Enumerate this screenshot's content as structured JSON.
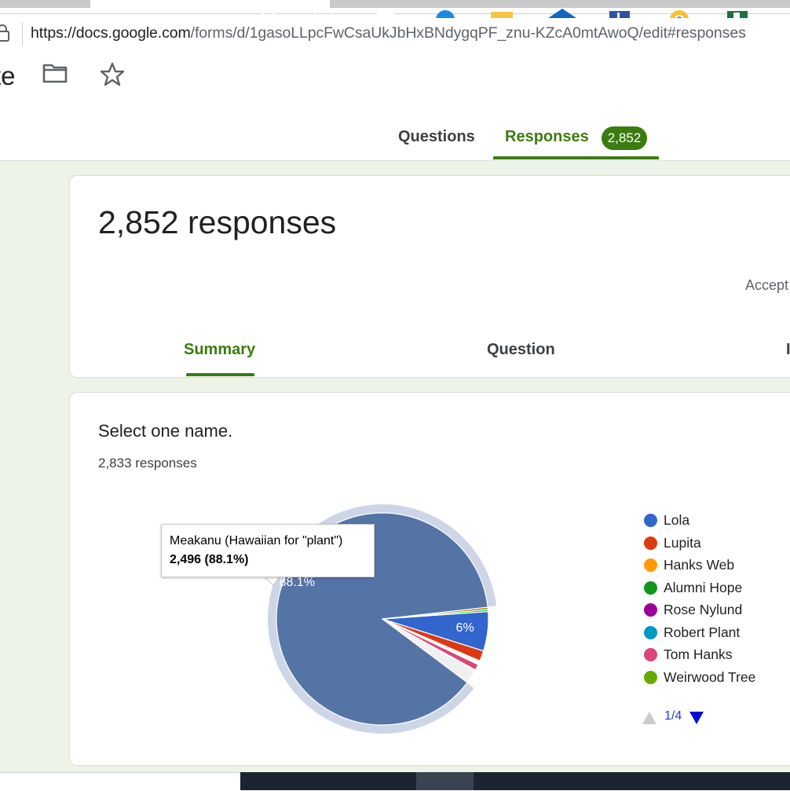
{
  "browser": {
    "url_base": "https://docs.google.com",
    "url_path": "/forms/d/1gasoLLpcFwCsaUkJbHxBNdygqPF_znu-KZcA0mtAwoQ/edit#responses"
  },
  "form": {
    "title_fragment": "te",
    "tabs": [
      {
        "label": "Questions"
      },
      {
        "label": "Responses",
        "badge": "2,852"
      }
    ]
  },
  "responses": {
    "total_label": "2,852 responses",
    "accepting_fragment": "Accept",
    "subtabs": [
      {
        "label": "Summary"
      },
      {
        "label": "Question"
      },
      {
        "label": "I"
      }
    ]
  },
  "question": {
    "title": "Select one name.",
    "count_label": "2,833 responses"
  },
  "tooltip": {
    "name": "Meakanu (Hawaiian for \"plant\")",
    "value": "2,496 (88.1%)"
  },
  "chart_data": {
    "type": "pie",
    "total": 2833,
    "slices": [
      {
        "name": "Lola",
        "percent": 6.0,
        "color": "#3366cc"
      },
      {
        "name": "Lupita",
        "percent": 1.6,
        "color": "#dc3912"
      },
      {
        "name": "Hanks Web",
        "percent": 0.15,
        "color": "#ff9900"
      },
      {
        "name": "Alumni Hope",
        "percent": 0.15,
        "color": "#109618"
      },
      {
        "name": "Rose Nylund",
        "percent": 0.15,
        "color": "#990099"
      },
      {
        "name": "Robert Plant",
        "percent": 0.15,
        "color": "#0099c6"
      },
      {
        "name": "Tom Hanks",
        "percent": 0.9,
        "color": "#dd4477"
      },
      {
        "name": "Weirwood Tree",
        "percent": 0.15,
        "color": "#66aa00"
      },
      {
        "name": "",
        "percent": 2.1,
        "color": "#f0f0f0"
      },
      {
        "name": "Meakanu (Hawaiian for \"plant\")",
        "value": 2496,
        "percent": 88.1,
        "color": "#5574a6",
        "highlighted": true
      },
      {
        "name": "",
        "percent": 0.35,
        "color": "#b77322"
      },
      {
        "name": "",
        "percent": 0.3,
        "color": "#16d620"
      }
    ],
    "data_labels": [
      {
        "slice": "Meakanu (Hawaiian for \"plant\")",
        "text": "88.1%"
      },
      {
        "slice": "Lola",
        "text": "6%"
      }
    ],
    "legend": {
      "placement": "right",
      "items": [
        "Lola",
        "Lupita",
        "Hanks Web",
        "Alumni Hope",
        "Rose Nylund",
        "Robert Plant",
        "Tom Hanks",
        "Weirwood Tree"
      ],
      "page": "1/4"
    }
  },
  "icons": [
    "lock-icon",
    "folder-icon",
    "star-icon",
    "pager-up-icon",
    "pager-down-icon"
  ]
}
